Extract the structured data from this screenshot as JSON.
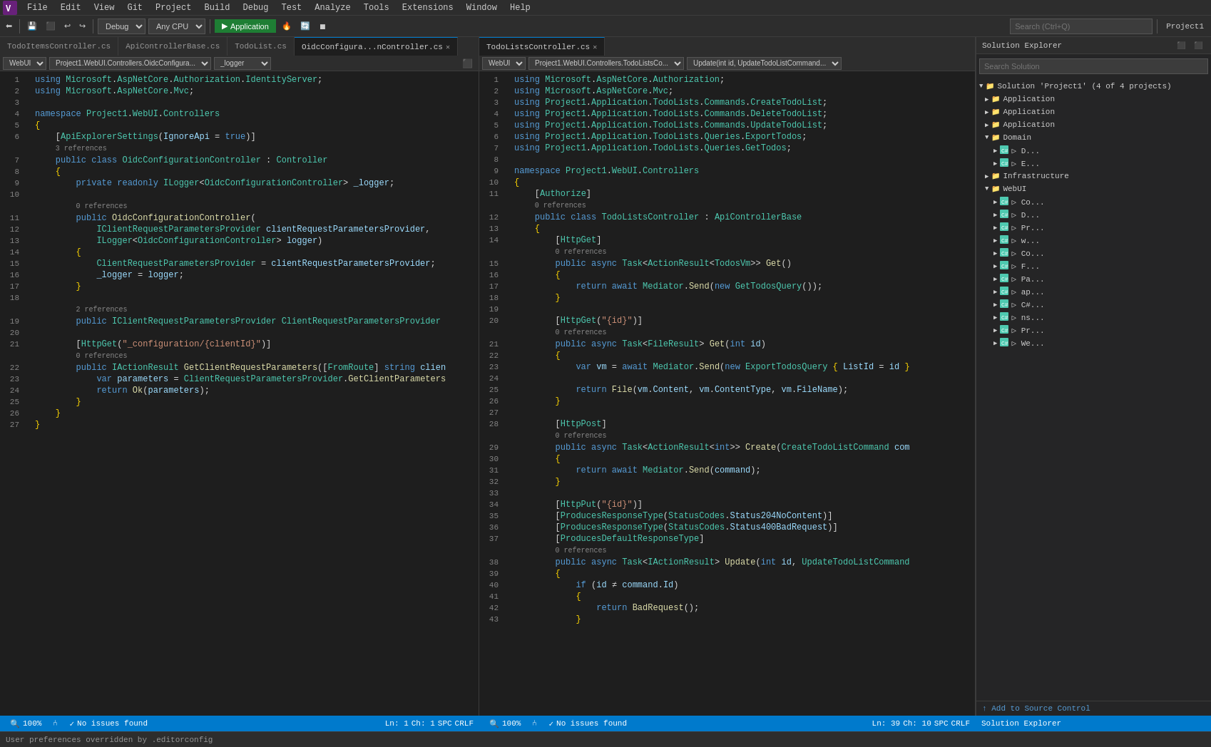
{
  "menubar": {
    "items": [
      "File",
      "Edit",
      "View",
      "Git",
      "Project",
      "Build",
      "Debug",
      "Test",
      "Analyze",
      "Tools",
      "Extensions",
      "Window",
      "Help"
    ]
  },
  "toolbar": {
    "search_placeholder": "Search (Ctrl+Q)",
    "project_name": "Project1",
    "config": "Debug",
    "platform": "Any CPU",
    "run_label": "Application"
  },
  "left_editor": {
    "tabs": [
      {
        "label": "TodoItemsController.cs",
        "active": false,
        "closable": false
      },
      {
        "label": "ApiControllerBase.cs",
        "active": false,
        "closable": false
      },
      {
        "label": "TodoList.cs",
        "active": false,
        "closable": false
      },
      {
        "label": "OidcConfigura...nController.cs",
        "active": true,
        "closable": true
      }
    ],
    "nav": {
      "scope": "WebUI",
      "class_path": "Project1.WebUI.Controllers.OidcConfigura...",
      "member": "_logger"
    },
    "status": {
      "zoom": "100%",
      "issues": "No issues found",
      "ln": "Ln: 1",
      "ch": "Ch: 1",
      "encoding": "SPC",
      "line_ending": "CRLF"
    }
  },
  "right_editor": {
    "tabs": [
      {
        "label": "TodoListsController.cs",
        "active": true,
        "closable": true
      }
    ],
    "nav": {
      "scope": "WebUI",
      "class_path": "Project1.WebUI.Controllers.TodoListsCo...",
      "member": "Update(int id, UpdateTodoListCommand..."
    },
    "status": {
      "zoom": "100%",
      "issues": "No issues found",
      "ln": "Ln: 39",
      "ch": "Ch: 10",
      "encoding": "SPC",
      "line_ending": "CRLF"
    }
  },
  "solution_explorer": {
    "title": "Solution Explorer",
    "search_placeholder": "Search Solution",
    "tree": [
      {
        "level": 0,
        "label": "Solution 'Project1'",
        "icon": "📁",
        "expanded": true
      },
      {
        "level": 1,
        "label": "Application",
        "icon": "📁",
        "expanded": false
      },
      {
        "level": 1,
        "label": "Application",
        "icon": "📁",
        "expanded": false
      },
      {
        "level": 1,
        "label": "Application",
        "icon": "📁",
        "expanded": false
      },
      {
        "level": 1,
        "label": "Domain",
        "icon": "📁",
        "expanded": true
      },
      {
        "level": 2,
        "label": "🔷 D...",
        "icon": "",
        "expanded": false
      },
      {
        "level": 1,
        "label": "🔷 E...",
        "icon": "",
        "expanded": false
      },
      {
        "level": 1,
        "label": "Infrastructure",
        "icon": "📁",
        "expanded": false
      },
      {
        "level": 1,
        "label": "WebUI",
        "icon": "📁",
        "expanded": true
      },
      {
        "level": 2,
        "label": "🔷 Co...",
        "icon": "",
        "expanded": false
      },
      {
        "level": 2,
        "label": "🔷 D...",
        "icon": "",
        "expanded": false
      },
      {
        "level": 2,
        "label": "🔷 Pr...",
        "icon": "",
        "expanded": false
      },
      {
        "level": 2,
        "label": "🔷 w...",
        "icon": "",
        "expanded": false
      },
      {
        "level": 2,
        "label": "🔷 Co...",
        "icon": "",
        "expanded": false
      },
      {
        "level": 2,
        "label": "🔷 F...",
        "icon": "",
        "expanded": false
      },
      {
        "level": 2,
        "label": "🔷 Pa...",
        "icon": "",
        "expanded": false
      },
      {
        "level": 2,
        "label": "🔷 ap...",
        "icon": "",
        "expanded": false
      },
      {
        "level": 2,
        "label": "🔷 C#...",
        "icon": "",
        "expanded": false
      },
      {
        "level": 2,
        "label": "🔷 ns...",
        "icon": "",
        "expanded": false
      },
      {
        "level": 2,
        "label": "🔷 Pr...",
        "icon": "",
        "expanded": false
      },
      {
        "level": 2,
        "label": "🔷 We...",
        "icon": "",
        "expanded": false
      }
    ]
  },
  "bottom_bar": {
    "message": "User preferences overridden by .editorconfig"
  },
  "left_code": [
    {
      "ln": "1",
      "indent": 0,
      "content": "<span class='kw'>using</span> <span class='ns'>Microsoft</span>.<span class='ns'>AspNetCore</span>.<span class='ns'>Authorization</span>.<span class='ns'>IdentityServer</span>;"
    },
    {
      "ln": "2",
      "indent": 0,
      "content": "<span class='kw'>using</span> <span class='ns'>Microsoft</span>.<span class='ns'>AspNetCore</span>.<span class='ns'>Mvc</span>;"
    },
    {
      "ln": "3",
      "indent": 0,
      "content": ""
    },
    {
      "ln": "4",
      "indent": 0,
      "content": "<span class='kw'>namespace</span> <span class='ns'>Project1</span>.<span class='ns'>WebUI</span>.<span class='ns'>Controllers</span>"
    },
    {
      "ln": "5",
      "indent": 0,
      "content": "<span class='bracket'>{</span>"
    },
    {
      "ln": "6",
      "indent": 1,
      "content": "    [<span class='type'>ApiExplorerSettings</span>(<span class='prop'>IgnoreApi</span> <span class='plain'>= </span><span class='kw'>true</span>)]"
    },
    {
      "ln": "",
      "indent": 1,
      "content": "    <span class='ref-hint'>3 references</span>"
    },
    {
      "ln": "7",
      "indent": 1,
      "content": "    <span class='kw'>public</span> <span class='kw'>class</span> <span class='type'>OidcConfigurationController</span> <span class='plain'>: </span><span class='type'>Controller</span>"
    },
    {
      "ln": "8",
      "indent": 1,
      "content": "    <span class='bracket'>{</span>"
    },
    {
      "ln": "9",
      "indent": 2,
      "content": "        <span class='kw'>private</span> <span class='kw'>readonly</span> <span class='type'>ILogger</span>&lt;<span class='type'>OidcConfigurationController</span>&gt; <span class='prop'>_logger</span>;"
    },
    {
      "ln": "10",
      "indent": 2,
      "content": ""
    },
    {
      "ln": "",
      "indent": 2,
      "content": "        <span class='ref-hint'>0 references</span>"
    },
    {
      "ln": "11",
      "indent": 2,
      "content": "        <span class='kw'>public</span> <span class='method'>OidcConfigurationController</span>("
    },
    {
      "ln": "12",
      "indent": 3,
      "content": "            <span class='type'>IClientRequestParametersProvider</span> <span class='prop'>clientRequestParametersProvider</span>,"
    },
    {
      "ln": "13",
      "indent": 3,
      "content": "            <span class='type'>ILogger</span>&lt;<span class='type'>OidcConfigurationController</span>&gt; <span class='prop'>logger</span>)"
    },
    {
      "ln": "14",
      "indent": 2,
      "content": "        <span class='bracket'>{</span>"
    },
    {
      "ln": "15",
      "indent": 3,
      "content": "            <span class='type'>ClientRequestParametersProvider</span> <span class='plain'>= </span><span class='prop'>clientRequestParametersProvider</span>;"
    },
    {
      "ln": "16",
      "indent": 3,
      "content": "            <span class='prop'>_logger</span> <span class='plain'>= </span><span class='prop'>logger</span>;"
    },
    {
      "ln": "17",
      "indent": 2,
      "content": "        <span class='bracket'>}</span>"
    },
    {
      "ln": "18",
      "indent": 2,
      "content": ""
    },
    {
      "ln": "",
      "indent": 2,
      "content": "        <span class='ref-hint'>2 references</span>"
    },
    {
      "ln": "19",
      "indent": 2,
      "content": "        <span class='kw'>public</span> <span class='type'>IClientRequestParametersProvider</span> <span class='type'>ClientRequestParametersProvider</span>"
    },
    {
      "ln": "20",
      "indent": 2,
      "content": ""
    },
    {
      "ln": "21",
      "indent": 2,
      "content": "        [<span class='type'>HttpGet</span>(<span class='str'>\"_configuration/{clientId}\"</span>)]"
    },
    {
      "ln": "",
      "indent": 2,
      "content": "        <span class='ref-hint'>0 references</span>"
    },
    {
      "ln": "22",
      "indent": 2,
      "content": "        <span class='kw'>public</span> <span class='type'>IActionResult</span> <span class='method'>GetClientRequestParameters</span>([<span class='type'>FromRoute</span>] <span class='kw'>string</span> <span class='prop'>clien</span>"
    },
    {
      "ln": "23",
      "indent": 3,
      "content": "            <span class='kw'>var</span> <span class='prop'>parameters</span> <span class='plain'>= </span><span class='type'>ClientRequestParametersProvider</span>.<span class='method'>GetClientParameters</span>"
    },
    {
      "ln": "24",
      "indent": 3,
      "content": "            <span class='kw'>return</span> <span class='method'>Ok</span>(<span class='prop'>parameters</span>);"
    },
    {
      "ln": "25",
      "indent": 2,
      "content": "        <span class='bracket'>}</span>"
    },
    {
      "ln": "26",
      "indent": 1,
      "content": "    <span class='bracket'>}</span>"
    },
    {
      "ln": "27",
      "indent": 0,
      "content": "<span class='bracket'>}</span>"
    }
  ],
  "right_code": [
    {
      "ln": "1",
      "content": "<span class='kw'>using</span> <span class='ns'>Microsoft</span>.<span class='ns'>AspNetCore</span>.<span class='ns'>Authorization</span>;"
    },
    {
      "ln": "2",
      "content": "<span class='kw'>using</span> <span class='ns'>Microsoft</span>.<span class='ns'>AspNetCore</span>.<span class='ns'>Mvc</span>;"
    },
    {
      "ln": "3",
      "content": "<span class='kw'>using</span> <span class='ns'>Project1</span>.<span class='ns'>Application</span>.<span class='ns'>TodoLists</span>.<span class='ns'>Commands</span>.<span class='ns'>CreateTodoList</span>;"
    },
    {
      "ln": "4",
      "content": "<span class='kw'>using</span> <span class='ns'>Project1</span>.<span class='ns'>Application</span>.<span class='ns'>TodoLists</span>.<span class='ns'>Commands</span>.<span class='ns'>DeleteTodoList</span>;"
    },
    {
      "ln": "5",
      "content": "<span class='kw'>using</span> <span class='ns'>Project1</span>.<span class='ns'>Application</span>.<span class='ns'>TodoLists</span>.<span class='ns'>Commands</span>.<span class='ns'>UpdateTodoList</span>;"
    },
    {
      "ln": "6",
      "content": "<span class='kw'>using</span> <span class='ns'>Project1</span>.<span class='ns'>Application</span>.<span class='ns'>TodoLists</span>.<span class='ns'>Queries</span>.<span class='ns'>ExportTodos</span>;"
    },
    {
      "ln": "7",
      "content": "<span class='kw'>using</span> <span class='ns'>Project1</span>.<span class='ns'>Application</span>.<span class='ns'>TodoLists</span>.<span class='ns'>Queries</span>.<span class='ns'>GetTodos</span>;"
    },
    {
      "ln": "8",
      "content": ""
    },
    {
      "ln": "9",
      "content": "<span class='kw'>namespace</span> <span class='ns'>Project1</span>.<span class='ns'>WebUI</span>.<span class='ns'>Controllers</span>"
    },
    {
      "ln": "10",
      "content": "<span class='bracket'>{</span>"
    },
    {
      "ln": "11",
      "content": "    [<span class='type'>Authorize</span>]"
    },
    {
      "ln": "",
      "content": "    <span class='ref-hint'>0 references</span>"
    },
    {
      "ln": "12",
      "content": "    <span class='kw'>public</span> <span class='kw'>class</span> <span class='type'>TodoListsController</span> <span class='plain'>: </span><span class='type'>ApiControllerBase</span>"
    },
    {
      "ln": "13",
      "content": "    <span class='bracket'>{</span>"
    },
    {
      "ln": "14",
      "content": "        [<span class='type'>HttpGet</span>]"
    },
    {
      "ln": "",
      "content": "        <span class='ref-hint'>0 references</span>"
    },
    {
      "ln": "15",
      "content": "        <span class='kw'>public</span> <span class='kw'>async</span> <span class='type'>Task</span>&lt;<span class='type'>ActionResult</span>&lt;<span class='type'>TodosVm</span>&gt;&gt; <span class='method'>Get</span>()"
    },
    {
      "ln": "16",
      "content": "        <span class='bracket'>{</span>"
    },
    {
      "ln": "17",
      "content": "            <span class='kw'>return</span> <span class='kw'>await</span> <span class='type'>Mediator</span>.<span class='method'>Send</span>(<span class='kw'>new</span> <span class='type'>GetTodosQuery</span>());"
    },
    {
      "ln": "18",
      "content": "        <span class='bracket'>}</span>"
    },
    {
      "ln": "19",
      "content": ""
    },
    {
      "ln": "20",
      "content": "        [<span class='type'>HttpGet</span>(<span class='str'>\"{id}\"</span>)]"
    },
    {
      "ln": "",
      "content": "        <span class='ref-hint'>0 references</span>"
    },
    {
      "ln": "21",
      "content": "        <span class='kw'>public</span> <span class='kw'>async</span> <span class='type'>Task</span>&lt;<span class='type'>FileResult</span>&gt; <span class='method'>Get</span>(<span class='kw'>int</span> <span class='prop'>id</span>)"
    },
    {
      "ln": "22",
      "content": "        <span class='bracket'>{</span>"
    },
    {
      "ln": "23",
      "content": "            <span class='kw'>var</span> <span class='prop'>vm</span> <span class='plain'>= </span><span class='kw'>await</span> <span class='type'>Mediator</span>.<span class='method'>Send</span>(<span class='kw'>new</span> <span class='type'>ExportTodosQuery</span> <span class='bracket'>{</span> <span class='prop'>ListId</span> <span class='plain'>= </span><span class='prop'>id</span> <span class='bracket'>}</span>"
    },
    {
      "ln": "24",
      "content": ""
    },
    {
      "ln": "25",
      "content": "            <span class='kw'>return</span> <span class='method'>File</span>(<span class='prop'>vm</span>.<span class='prop'>Content</span>, <span class='prop'>vm</span>.<span class='prop'>ContentType</span>, <span class='prop'>vm</span>.<span class='prop'>FileName</span>);"
    },
    {
      "ln": "26",
      "content": "        <span class='bracket'>}</span>"
    },
    {
      "ln": "27",
      "content": ""
    },
    {
      "ln": "28",
      "content": "        [<span class='type'>HttpPost</span>]"
    },
    {
      "ln": "",
      "content": "        <span class='ref-hint'>0 references</span>"
    },
    {
      "ln": "29",
      "content": "        <span class='kw'>public</span> <span class='kw'>async</span> <span class='type'>Task</span>&lt;<span class='type'>ActionResult</span>&lt;<span class='kw'>int</span>&gt;&gt; <span class='method'>Create</span>(<span class='type'>CreateTodoListCommand</span> <span class='prop'>com</span>"
    },
    {
      "ln": "30",
      "content": "        <span class='bracket'>{</span>"
    },
    {
      "ln": "31",
      "content": "            <span class='kw'>return</span> <span class='kw'>await</span> <span class='type'>Mediator</span>.<span class='method'>Send</span>(<span class='prop'>command</span>);"
    },
    {
      "ln": "32",
      "content": "        <span class='bracket'>}</span>"
    },
    {
      "ln": "33",
      "content": ""
    },
    {
      "ln": "34",
      "content": "        [<span class='type'>HttpPut</span>(<span class='str'>\"{id}\"</span>)]"
    },
    {
      "ln": "35",
      "content": "        [<span class='type'>ProducesResponseType</span>(<span class='type'>StatusCodes</span>.<span class='prop'>Status204NoContent</span>)]"
    },
    {
      "ln": "36",
      "content": "        [<span class='type'>ProducesResponseType</span>(<span class='type'>StatusCodes</span>.<span class='prop'>Status400BadRequest</span>)]"
    },
    {
      "ln": "37",
      "content": "        [<span class='type'>ProducesDefaultResponseType</span>]"
    },
    {
      "ln": "",
      "content": "        <span class='ref-hint'>0 references</span>"
    },
    {
      "ln": "38",
      "content": "        <span class='kw'>public</span> <span class='kw'>async</span> <span class='type'>Task</span>&lt;<span class='type'>IActionResult</span>&gt; <span class='method'>Update</span>(<span class='kw'>int</span> <span class='prop'>id</span>, <span class='type'>UpdateTodoListCommand</span>"
    },
    {
      "ln": "39",
      "content": "        <span class='bracket'>{</span>"
    },
    {
      "ln": "40",
      "content": "            <span class='kw'>if</span> (<span class='prop'>id</span> <span class='plain'>≠ </span><span class='prop'>command</span>.<span class='prop'>Id</span>)"
    },
    {
      "ln": "41",
      "content": "            <span class='bracket'>{</span>"
    },
    {
      "ln": "42",
      "content": "                <span class='kw'>return</span> <span class='method'>BadRequest</span>();"
    },
    {
      "ln": "43",
      "content": "            <span class='bracket'>}</span>"
    }
  ]
}
